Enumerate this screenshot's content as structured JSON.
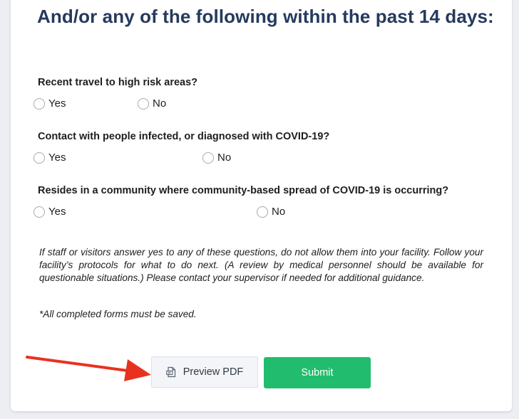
{
  "form": {
    "heading": "And/or any of the following within the past 14 days:",
    "questions": [
      {
        "text": "Recent travel to high risk areas?",
        "yes": "Yes",
        "no": "No"
      },
      {
        "text": "Contact with people infected, or diagnosed with COVID-19?",
        "yes": "Yes",
        "no": "No"
      },
      {
        "text": "Resides in a community where community-based spread of COVID-19 is occurring?",
        "yes": "Yes",
        "no": "No"
      }
    ],
    "note": "If staff or visitors answer yes to any of these questions, do not allow them into your facility. Follow your facility’s protocols for what to do next. (A review by medical personnel should be available for questionable situations.) Please contact your supervisor if needed for additional guidance.",
    "saved_note": "*All completed forms must be saved."
  },
  "actions": {
    "preview_label": "Preview PDF",
    "submit_label": "Submit"
  },
  "icons": {
    "preview": "pdf-document-icon",
    "annotation": "red-arrow"
  },
  "colors": {
    "heading": "#253a5e",
    "submit": "#21bc6d",
    "arrow": "#e8321f"
  }
}
